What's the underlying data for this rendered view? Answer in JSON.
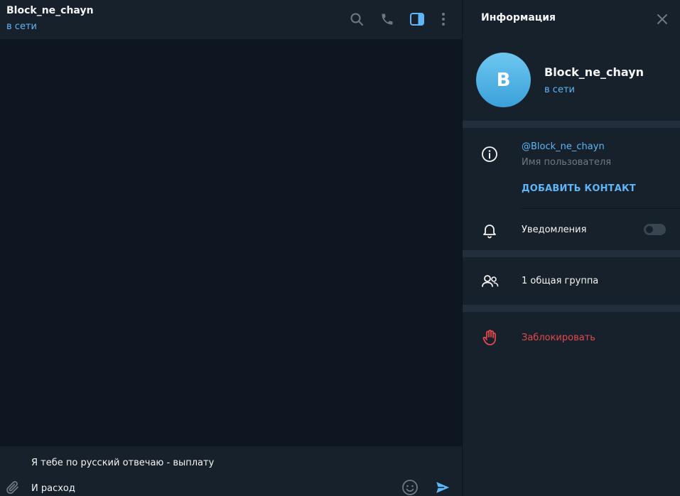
{
  "chat": {
    "title": "Block_ne_chayn",
    "status": "в сети",
    "icons": [
      "search-icon",
      "phone-icon",
      "sidebar-toggle-icon",
      "more-vertical-icon"
    ],
    "composer": {
      "line1": "Я тебе по русский отвечаю - выплату",
      "line2": "И расход"
    }
  },
  "info": {
    "title": "Информация",
    "avatar_letter": "B",
    "name": "Block_ne_chayn",
    "status": "в сети",
    "username": "@Block_ne_chayn",
    "username_caption": "Имя пользователя",
    "add_contact": "ДОБАВИТЬ КОНТАКТ",
    "notifications_label": "Уведомления",
    "notifications_on": false,
    "common_groups": "1 общая группа",
    "block": "Заблокировать"
  },
  "colors": {
    "accent": "#5eb5f7",
    "danger": "#e5484d",
    "panel": "#17212b",
    "chat_bg": "#0e1621"
  }
}
